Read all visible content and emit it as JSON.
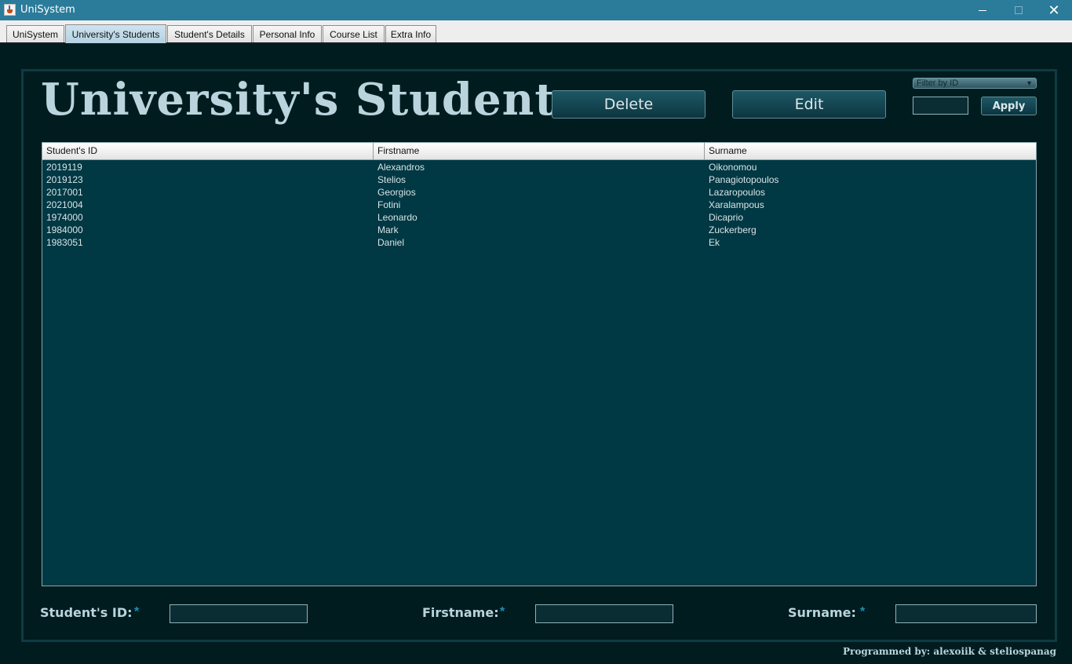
{
  "window": {
    "title": "UniSystem"
  },
  "tabs": [
    {
      "label": "UniSystem"
    },
    {
      "label": "University's Students"
    },
    {
      "label": "Student's Details"
    },
    {
      "label": "Personal Info"
    },
    {
      "label": "Course List"
    },
    {
      "label": "Extra Info"
    }
  ],
  "active_tab": "University's Students",
  "page": {
    "title": "University's Students:",
    "delete_label": "Delete",
    "edit_label": "Edit",
    "filter_selected": "Filter by ID",
    "filter_value": "",
    "apply_label": "Apply"
  },
  "table": {
    "columns": [
      "Student's ID",
      "Firstname",
      "Surname"
    ],
    "rows": [
      [
        "2019119",
        "Alexandros",
        "Oikonomou"
      ],
      [
        "2019123",
        "Stelios",
        "Panagiotopoulos"
      ],
      [
        "2017001",
        "Georgios",
        "Lazaropoulos"
      ],
      [
        "2021004",
        "Fotini",
        "Xaralampous"
      ],
      [
        "1974000",
        "Leonardo",
        "Dicaprio"
      ],
      [
        "1984000",
        "Mark",
        "Zuckerberg"
      ],
      [
        "1983051",
        "Daniel",
        "Ek"
      ]
    ]
  },
  "form": {
    "id_label": "Student's ID:",
    "firstname_label": "Firstname:",
    "surname_label": "Surname:",
    "required_mark": "*",
    "id_value": "",
    "firstname_value": "",
    "surname_value": ""
  },
  "footer": "Programmed by: alexoiik & steliospanag",
  "colors": {
    "background": "#001c1f",
    "title_bar": "#2b7b9b",
    "table_bg": "#003843",
    "heading_text": "#b9d4dc",
    "required_mark": "#1f8fb0"
  },
  "icons": [
    "java-app-icon",
    "minimize-icon",
    "maximize-icon",
    "close-icon",
    "dropdown-arrow-icon"
  ]
}
